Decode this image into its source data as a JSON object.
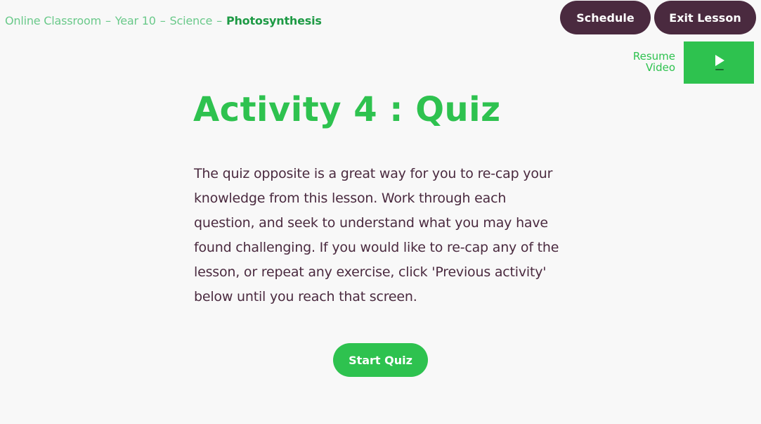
{
  "breadcrumb": {
    "items": [
      "Online Classroom",
      "Year 10",
      "Science",
      "Photosynthesis"
    ],
    "separator": "–"
  },
  "header": {
    "schedule_label": "Schedule",
    "exit_label": "Exit Lesson"
  },
  "video": {
    "resume_line1": "Resume",
    "resume_line2": "Video",
    "icon": "play-icon"
  },
  "activity": {
    "title": "Activity 4 : Quiz",
    "description": "The quiz opposite is a great way for you to re-cap your knowledge from this lesson. Work through each question, and seek to understand what you may have found challenging. If you would like to re-cap any of the lesson, or repeat any exercise, click 'Previous activity' below until you reach that screen.",
    "start_label": "Start Quiz"
  },
  "colors": {
    "accent_green": "#2ec24f",
    "breadcrumb_light": "#6ac98a",
    "breadcrumb_current": "#1e9a45",
    "dark_plum": "#4a2a3f",
    "background": "#f8f8f8"
  }
}
